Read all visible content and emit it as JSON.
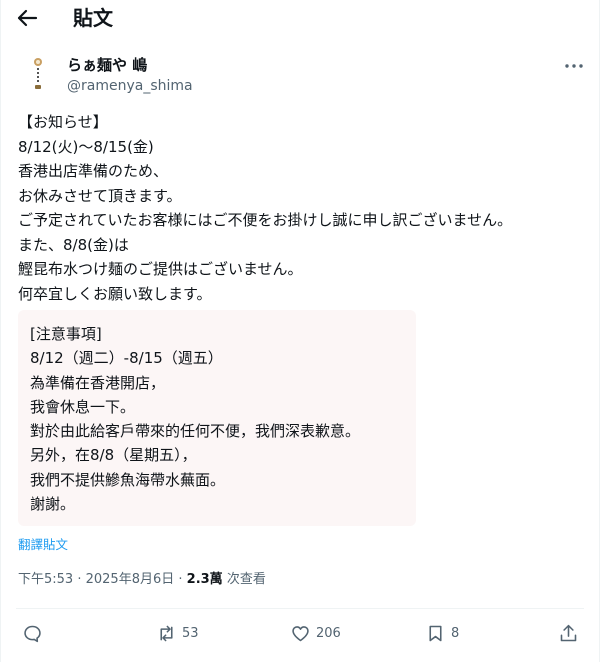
{
  "header": {
    "title": "貼文"
  },
  "author": {
    "name": "らぁ麺や 嶋",
    "handle": "@ramenya_shima"
  },
  "post": {
    "body": "【お知らせ】\n8/12(火)〜8/15(金)\n香港出店準備のため、\nお休みさせて頂きます。\nご予定されていたお客様にはご不便をお掛けし誠に申し訳ございません。\nまた、8/8(金)は\n鰹昆布水つけ麺のご提供はございません。\n何卒宜しくお願い致します。",
    "notice": "[注意事項]\n8/12（週二）-8/15（週五）\n為準備在香港開店，\n我會休息一下。\n對於由此給客戶帶來的任何不便，我們深表歉意。\n另外，在8/8（星期五），\n我們不提供鰺魚海帶水蕪面。\n謝謝。",
    "translate_label": "翻譯貼文"
  },
  "meta": {
    "time": "下午5:53",
    "date": "2025年8月6日",
    "views_count": "2.3萬",
    "views_label": "次查看",
    "separator": " · "
  },
  "actions": {
    "reply_count": "",
    "repost_count": "53",
    "like_count": "206",
    "bookmark_count": "8"
  },
  "icons": {
    "back": "back-arrow-icon",
    "more": "more-icon",
    "reply": "reply-icon",
    "repost": "repost-icon",
    "like": "like-icon",
    "bookmark": "bookmark-icon",
    "share": "share-icon"
  }
}
